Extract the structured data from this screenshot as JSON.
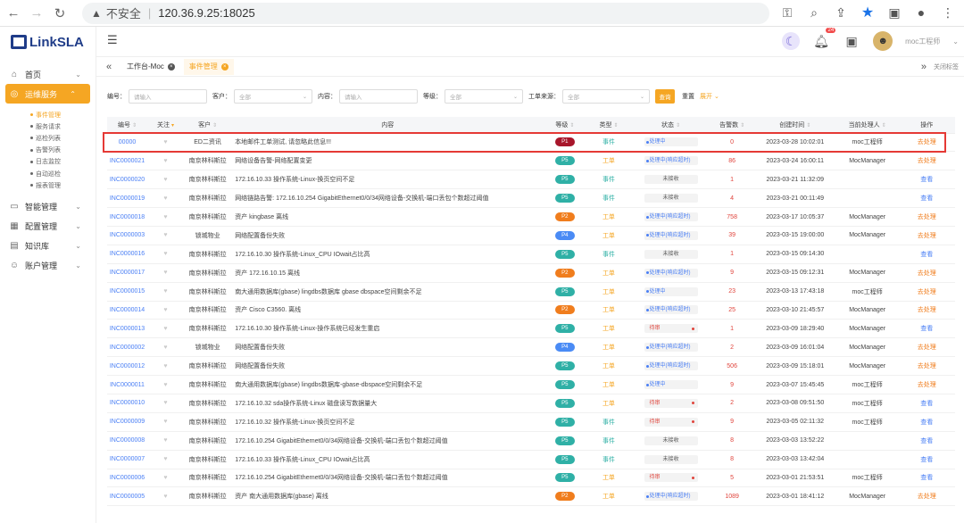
{
  "browser": {
    "insecure": "不安全",
    "url": "120.36.9.25:18025"
  },
  "sidebar": {
    "logo": "LinkSLA",
    "items": [
      {
        "label": "首页",
        "icon": "home-icon"
      },
      {
        "label": "运维服务",
        "icon": "globe-icon",
        "active": true
      },
      {
        "label": "智能管理",
        "icon": "monitor-icon"
      },
      {
        "label": "配置管理",
        "icon": "config-icon"
      },
      {
        "label": "知识库",
        "icon": "book-icon"
      },
      {
        "label": "账户管理",
        "icon": "user-icon"
      }
    ],
    "sub_items": [
      "事件管理",
      "服务请求",
      "巡检列表",
      "告警列表",
      "日志监控",
      "自动巡检",
      "报表管理"
    ]
  },
  "topbar": {
    "badge": "24",
    "username": "moc工程师"
  },
  "tabs": [
    {
      "label": "工作台-Moc",
      "active": false
    },
    {
      "label": "事件管理",
      "active": true
    }
  ],
  "tabs_close_label": "关闭标签",
  "filter": {
    "fields": [
      {
        "label": "编号：",
        "placeholder": "请输入"
      },
      {
        "label": "客户：",
        "placeholder": "全部"
      },
      {
        "label": "内容：",
        "placeholder": "请输入"
      },
      {
        "label": "等级：",
        "placeholder": "全部"
      },
      {
        "label": "工单来源：",
        "placeholder": "全部"
      }
    ],
    "search": "查询",
    "reset": "重置",
    "expand": "展开"
  },
  "table": {
    "headers": [
      "编号",
      "关注",
      "客户",
      "内容",
      "等级",
      "类型",
      "状态",
      "告警数",
      "创建时间",
      "当前处理人",
      "操作"
    ],
    "rows": [
      {
        "id": "00000",
        "client": "ED二资讯",
        "content": "本地邮件工单测试, 请忽略此信息!!!",
        "level": "P1",
        "type": "事件",
        "status": "处理中",
        "status_style": "blue",
        "alarms": "0",
        "time": "2023-03-28 10:02:01",
        "handler": "moc工程师",
        "op": "去处理"
      },
      {
        "id": "INC0000021",
        "client": "南京林科斯拉",
        "content": "网络设备告警-网络配置变更",
        "level": "P5",
        "type": "工单",
        "status": "处理中(响应超时)",
        "status_style": "blue",
        "alarms": "86",
        "time": "2023-03-24 16:00:11",
        "handler": "MocManager",
        "op": "去处理"
      },
      {
        "id": "INC0000020",
        "client": "南京林科斯拉",
        "content": "172.16.10.33 操作系统-Linux-换页空间不足",
        "level": "P5",
        "type": "事件",
        "status": "未接收",
        "status_style": "gray",
        "alarms": "1",
        "time": "2023-03-21 11:32:09",
        "handler": "",
        "op": "查看"
      },
      {
        "id": "INC0000019",
        "client": "南京林科斯拉",
        "content": "网络链路告警: 172.16.10.254 GigabitEthernet0/0/34网络设备-交换机-端口丢包个数超过阈值",
        "level": "P5",
        "type": "事件",
        "status": "未接收",
        "status_style": "gray",
        "alarms": "4",
        "time": "2023-03-21 00:11:49",
        "handler": "",
        "op": "查看"
      },
      {
        "id": "INC0000018",
        "client": "南京林科斯拉",
        "content": "资产 kingbase 离线",
        "level": "P2",
        "type": "工单",
        "status": "处理中(响应超时)",
        "status_style": "blue",
        "alarms": "758",
        "time": "2023-03-17 10:05:37",
        "handler": "MocManager",
        "op": "去处理"
      },
      {
        "id": "INC0000003",
        "client": "锁城物业",
        "content": "网络配置备份失败",
        "level": "P4",
        "type": "工单",
        "status": "处理中(响应超时)",
        "status_style": "blue",
        "alarms": "39",
        "time": "2023-03-15 19:00:00",
        "handler": "MocManager",
        "op": "去处理"
      },
      {
        "id": "INC0000016",
        "client": "南京林科斯拉",
        "content": "172.16.10.30 操作系统-Linux_CPU IOwait占比高",
        "level": "P5",
        "type": "事件",
        "status": "未接收",
        "status_style": "gray",
        "alarms": "1",
        "time": "2023-03-15 09:14:30",
        "handler": "",
        "op": "查看"
      },
      {
        "id": "INC0000017",
        "client": "南京林科斯拉",
        "content": "资产 172.16.10.15 离线",
        "level": "P2",
        "type": "工单",
        "status": "处理中(响应超时)",
        "status_style": "blue",
        "alarms": "9",
        "time": "2023-03-15 09:12:31",
        "handler": "MocManager",
        "op": "去处理"
      },
      {
        "id": "INC0000015",
        "client": "南京林科斯拉",
        "content": "南大通用数据库(gbase) lingdbs数据库 gbase dbspace空间剩余不足",
        "level": "P5",
        "type": "工单",
        "status": "处理中",
        "status_style": "blue",
        "alarms": "23",
        "time": "2023-03-13 17:43:18",
        "handler": "moc工程师",
        "op": "去处理"
      },
      {
        "id": "INC0000014",
        "client": "南京林科斯拉",
        "content": "资产 Cisco C3560. 离线",
        "level": "P2",
        "type": "工单",
        "status": "处理中(响应超时)",
        "status_style": "blue",
        "alarms": "25",
        "time": "2023-03-10 21:45:57",
        "handler": "MocManager",
        "op": "去处理"
      },
      {
        "id": "INC0000013",
        "client": "南京林科斯拉",
        "content": "172.16.10.30 操作系统-Linux-操作系统已经发生重启",
        "level": "P5",
        "type": "工单",
        "status": "待审",
        "status_style": "red",
        "alarms": "1",
        "time": "2023-03-09 18:29:40",
        "handler": "MocManager",
        "op": "查看"
      },
      {
        "id": "INC0000002",
        "client": "锁城物业",
        "content": "网络配置备份失败",
        "level": "P4",
        "type": "工单",
        "status": "处理中(响应超时)",
        "status_style": "blue",
        "alarms": "2",
        "time": "2023-03-09 16:01:04",
        "handler": "MocManager",
        "op": "去处理"
      },
      {
        "id": "INC0000012",
        "client": "南京林科斯拉",
        "content": "网络配置备份失败",
        "level": "P5",
        "type": "工单",
        "status": "处理中(响应超时)",
        "status_style": "blue",
        "alarms": "506",
        "time": "2023-03-09 15:18:01",
        "handler": "MocManager",
        "op": "去处理"
      },
      {
        "id": "INC0000011",
        "client": "南京林科斯拉",
        "content": "南大通用数据库(gbase) lingdbs数据库-gbase-dbspace空间剩余不足",
        "level": "P5",
        "type": "工单",
        "status": "处理中",
        "status_style": "blue",
        "alarms": "9",
        "time": "2023-03-07 15:45:45",
        "handler": "moc工程师",
        "op": "去处理"
      },
      {
        "id": "INC0000010",
        "client": "南京林科斯拉",
        "content": "172.16.10.32 sda操作系统-Linux 磁盘读写数据量大",
        "level": "P5",
        "type": "工单",
        "status": "待审",
        "status_style": "red",
        "alarms": "2",
        "time": "2023-03-08 09:51:50",
        "handler": "moc工程师",
        "op": "查看"
      },
      {
        "id": "INC0000009",
        "client": "南京林科斯拉",
        "content": "172.16.10.32 操作系统-Linux-换页空间不足",
        "level": "P5",
        "type": "事件",
        "status": "待审",
        "status_style": "red",
        "alarms": "9",
        "time": "2023-03-05 02:11:32",
        "handler": "moc工程师",
        "op": "查看"
      },
      {
        "id": "INC0000008",
        "client": "南京林科斯拉",
        "content": "172.16.10.254 GigabitEthernet0/0/34网络设备-交换机-端口丢包个数超过阈值",
        "level": "P5",
        "type": "事件",
        "status": "未接收",
        "status_style": "gray",
        "alarms": "8",
        "time": "2023-03-03 13:52:22",
        "handler": "",
        "op": "查看"
      },
      {
        "id": "INC0000007",
        "client": "南京林科斯拉",
        "content": "172.16.10.33 操作系统-Linux_CPU IOwait占比高",
        "level": "P5",
        "type": "事件",
        "status": "未接收",
        "status_style": "gray",
        "alarms": "8",
        "time": "2023-03-03 13:42:04",
        "handler": "",
        "op": "查看"
      },
      {
        "id": "INC0000006",
        "client": "南京林科斯拉",
        "content": "172.16.10.254 GigabitEthernet0/0/34网络设备-交换机-端口丢包个数超过阈值",
        "level": "P5",
        "type": "工单",
        "status": "待审",
        "status_style": "red",
        "alarms": "5",
        "time": "2023-03-01 21:53:51",
        "handler": "moc工程师",
        "op": "查看"
      },
      {
        "id": "INC0000005",
        "client": "南京林科斯拉",
        "content": "资产 南大通用数据库(gbase) 离线",
        "level": "P2",
        "type": "工单",
        "status": "处理中(响应超时)",
        "status_style": "blue",
        "alarms": "1089",
        "time": "2023-03-01 18:41:12",
        "handler": "MocManager",
        "op": "去处理"
      }
    ]
  }
}
